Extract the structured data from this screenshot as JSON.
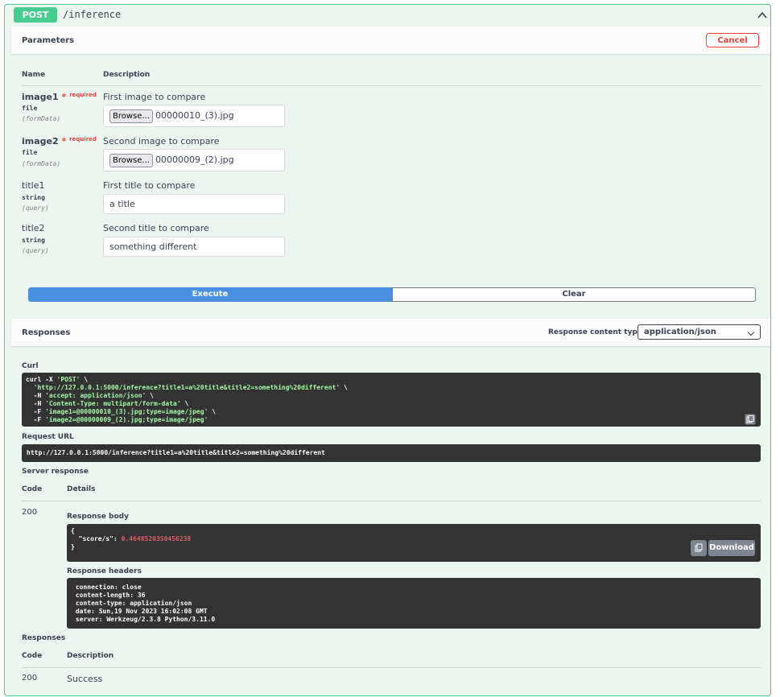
{
  "summary": {
    "method": "POST",
    "path": "/inference"
  },
  "parameters": {
    "title": "Parameters",
    "cancel_label": "Cancel",
    "col_name": "Name",
    "col_description": "Description",
    "required_label": "required",
    "items": [
      {
        "name": "image1",
        "type": "file",
        "in": "(formData)",
        "description": "First image to compare",
        "browse_label": "Browse...",
        "value": "00000010_(3).jpg"
      },
      {
        "name": "image2",
        "type": "file",
        "in": "(formData)",
        "description": "Second image to compare",
        "browse_label": "Browse...",
        "value": "00000009_(2).jpg"
      },
      {
        "name": "title1",
        "type": "string",
        "in": "(query)",
        "description": "First title to compare",
        "value": "a title"
      },
      {
        "name": "title2",
        "type": "string",
        "in": "(query)",
        "description": "Second title to compare",
        "value": "something different"
      }
    ]
  },
  "actions": {
    "execute_label": "Execute",
    "clear_label": "Clear"
  },
  "responses_header": {
    "title": "Responses",
    "content_type_label": "Response content type",
    "content_type_value": "application/json"
  },
  "curl": {
    "label": "Curl",
    "l1": "curl -X ",
    "l1s": "'POST'",
    "l1e": " \\",
    "l2s": "'http://127.0.0.1:5000/inference?title1=a%20title&title2=something%20different'",
    "l2e": " \\",
    "l3p": "  -H ",
    "l3s": "'accept: application/json'",
    "l3e": " \\",
    "l4p": "  -H ",
    "l4s": "'Content-Type: multipart/form-data'",
    "l4e": " \\",
    "l5p": "  -F ",
    "l5s": "'image1=@00000010_(3).jpg;type=image/jpeg'",
    "l5e": " \\",
    "l6p": "  -F ",
    "l6s": "'image2=@00000009_(2).jpg;type=image/jpeg'"
  },
  "request_url": {
    "label": "Request URL",
    "value": "http://127.0.0.1:5000/inference?title1=a%20title&title2=something%20different"
  },
  "server_response": {
    "label": "Server response",
    "col_code": "Code",
    "col_details": "Details",
    "code": "200",
    "body_label": "Response body",
    "body_open": "{",
    "body_key": "  \"score/s\": ",
    "body_value": "0.4648520350456238",
    "body_close": "}",
    "download_label": "Download",
    "headers_label": "Response headers",
    "headers": [
      " connection: close ",
      " content-length: 36 ",
      " content-type: application/json ",
      " date: Sun,19 Nov 2023 16:02:08 GMT ",
      " server: Werkzeug/2.3.8 Python/3.11.0 "
    ]
  },
  "responses": {
    "label": "Responses",
    "col_code": "Code",
    "col_description": "Description",
    "code": "200",
    "description": "Success"
  },
  "colors": {
    "post": "#49cc90",
    "execute": "#4990e2",
    "cancel": "#f93e3e",
    "code_bg": "#333333"
  },
  "icons": [
    "chevron-up-icon",
    "copy-icon"
  ]
}
